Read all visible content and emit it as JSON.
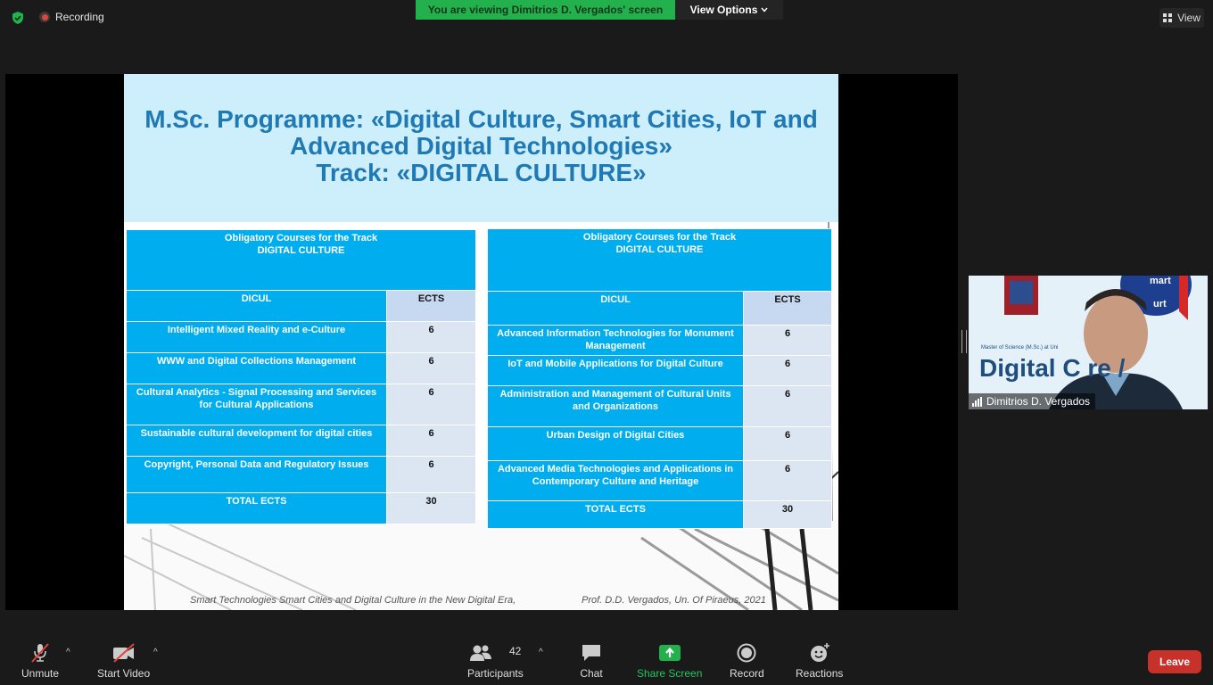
{
  "topbar": {
    "recording_label": "Recording",
    "viewing_banner": "You are viewing Dimitrios D. Vergados' screen",
    "view_options_label": "View Options",
    "view_label": "View"
  },
  "slide": {
    "title_line1": "M.Sc. Programme: «Digital Culture, Smart Cities, IoT and",
    "title_line2": "Advanced Digital Technologies»",
    "title_line3": "Track: «DIGITAL CULTURE»",
    "footer_left": "Smart Technologies Smart Cities and Digital Culture in the New Digital Era,",
    "footer_right": "Prof. D.D. Vergados, Un. Of Piraeus, 2021",
    "left_table": {
      "header_line1": "Obligatory Courses for the Track",
      "header_line2": "DIGITAL CULTURE",
      "col_course": "DICUL",
      "col_ects": "ECTS",
      "rows": [
        {
          "course": "Intelligent Mixed Reality and e-Culture",
          "ects": "6"
        },
        {
          "course": "WWW and Digital Collections Management",
          "ects": "6"
        },
        {
          "course": "Cultural Analytics - Signal Processing and Services for Cultural Applications",
          "ects": "6"
        },
        {
          "course": "Sustainable cultural development for digital cities",
          "ects": "6"
        },
        {
          "course": "Copyright, Personal Data and Regulatory Issues",
          "ects": "6"
        }
      ],
      "total_label": "TOTAL ECTS",
      "total_value": "30"
    },
    "right_table": {
      "header_line1": "Obligatory Courses for the Track",
      "header_line2": "DIGITAL CULTURE",
      "col_course": "DICUL",
      "col_ects": "ECTS",
      "rows": [
        {
          "course": "Advanced Information Technologies for Monument Management",
          "ects": "6"
        },
        {
          "course": "IoT and Mobile Applications for Digital Culture",
          "ects": "6"
        },
        {
          "course": "Administration and Management of Cultural Units and Organizations",
          "ects": "6"
        },
        {
          "course": "Urban Design of Digital Cities",
          "ects": "6"
        },
        {
          "course": "Advanced Media Technologies and Applications in Contemporary Culture and Heritage",
          "ects": "6"
        }
      ],
      "total_label": "TOTAL ECTS",
      "total_value": "30"
    }
  },
  "participant_video": {
    "name": "Dimitrios D. Vergados",
    "background_small_text": "Master of Science (M.Sc.) at Uni",
    "background_big_text": "Digital C   re /",
    "background_top_text_1": "mart",
    "background_top_text_2": "urt"
  },
  "toolbar": {
    "unmute_label": "Unmute",
    "start_video_label": "Start Video",
    "participants_label": "Participants",
    "participants_count": "42",
    "chat_label": "Chat",
    "share_screen_label": "Share Screen",
    "record_label": "Record",
    "reactions_label": "Reactions",
    "leave_label": "Leave"
  },
  "colors": {
    "banner_green": "#22b14c",
    "slide_title_blue": "#1f79b4",
    "table_cyan": "#00aeef",
    "leave_red": "#c8302a"
  }
}
